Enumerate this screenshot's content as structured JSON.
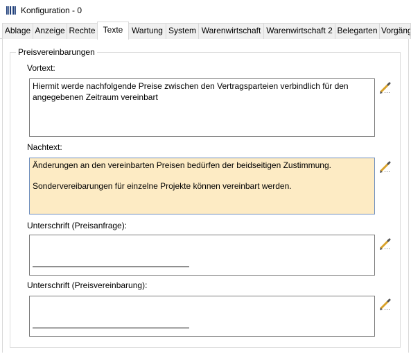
{
  "window": {
    "title": "Konfiguration - 0"
  },
  "tabs": [
    {
      "label": "Ablage"
    },
    {
      "label": "Anzeige"
    },
    {
      "label": "Rechte"
    },
    {
      "label": "Texte",
      "active": true
    },
    {
      "label": "Wartung"
    },
    {
      "label": "System"
    },
    {
      "label": "Warenwirtschaft"
    },
    {
      "label": "Warenwirtschaft 2"
    },
    {
      "label": "Belegarten"
    },
    {
      "label": "Vorgänge"
    }
  ],
  "group": {
    "title": "Preisvereinbarungen"
  },
  "fields": {
    "vortext": {
      "label": "Vortext:",
      "value": "Hiermit werde nachfolgende Preise zwischen den Vertragsparteien verbindlich für den angegebenen Zeitraum vereinbart"
    },
    "nachtext": {
      "label": "Nachtext:",
      "line1": "Änderungen an den vereinbarten Preisen bedürfen der beidseitigen Zustimmung.",
      "line2": "Sondervereibarungen für einzelne Projekte können vereinbart werden."
    },
    "unterschrift_anfrage": {
      "label": "Unterschrift (Preisanfrage):"
    },
    "unterschrift_vereinbarung": {
      "label": "Unterschrift (Preisvereinbarung):"
    }
  },
  "colors": {
    "highlight_background": "#fdebc4",
    "pencil_body": "#d9a22a",
    "pencil_tip": "#555555"
  },
  "icons": {
    "app": "app-barcode-icon",
    "edit": "pencil-icon"
  }
}
